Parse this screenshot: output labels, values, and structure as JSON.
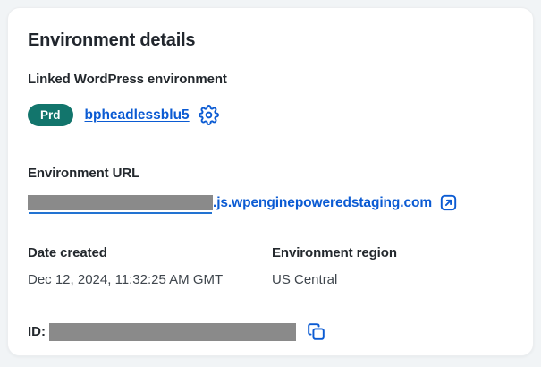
{
  "card": {
    "title": "Environment details",
    "linked_environment": {
      "label": "Linked WordPress environment",
      "badge_label": "Prd",
      "environment_name": "bpheadlessblu5"
    },
    "environment_url": {
      "label": "Environment URL",
      "visible_suffix": ".js.wpenginepoweredstaging.com",
      "redacted_prefix": true
    },
    "date_created": {
      "label": "Date created",
      "value": "Dec 12, 2024, 11:32:25 AM GMT"
    },
    "environment_region": {
      "label": "Environment region",
      "value": "US Central"
    },
    "id_row": {
      "label": "ID:",
      "redacted_value": true
    }
  },
  "icons": {
    "settings": "gear-icon",
    "open_in_new": "external-link-icon",
    "copy": "copy-icon"
  },
  "colors": {
    "badge_teal": "#12756c",
    "link_blue": "#0b5bd3",
    "redaction_gray": "#8a8a8a",
    "card_background": "#ffffff",
    "page_background": "#f1f4f6",
    "heading_text": "#21262d",
    "body_text": "#3f464d"
  }
}
